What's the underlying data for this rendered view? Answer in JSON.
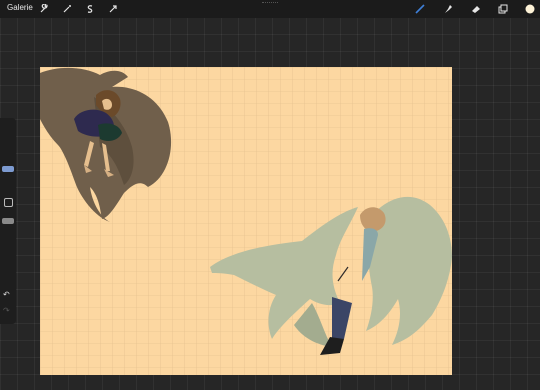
{
  "topbar": {
    "gallery_label": "Galerie",
    "left_tools": [
      "wrench-icon",
      "magic-wand-icon",
      "selection-s-icon",
      "transform-arrow-icon"
    ],
    "right_tools": [
      "brush-icon",
      "smudge-icon",
      "eraser-icon",
      "layers-icon"
    ],
    "active_tool": "brush-icon",
    "accent_color": "#3f7fd8",
    "current_color": "#fdf2d7"
  },
  "sidebar": {
    "buttons": [
      "modify-square-button",
      "undo-button",
      "redo-button"
    ]
  },
  "canvas": {
    "background_color": "#fcd7a1",
    "grid": true,
    "palette": {
      "brown_wings": "#705f4b",
      "green_wings": "#b6bea0",
      "hair_brown": "#6b4a2a",
      "hair_curly": "#c49a6c",
      "cloth_navy": "#2e2a4f",
      "cloth_dark": "#1e1e1e",
      "skin": "#e6bf8e"
    }
  }
}
